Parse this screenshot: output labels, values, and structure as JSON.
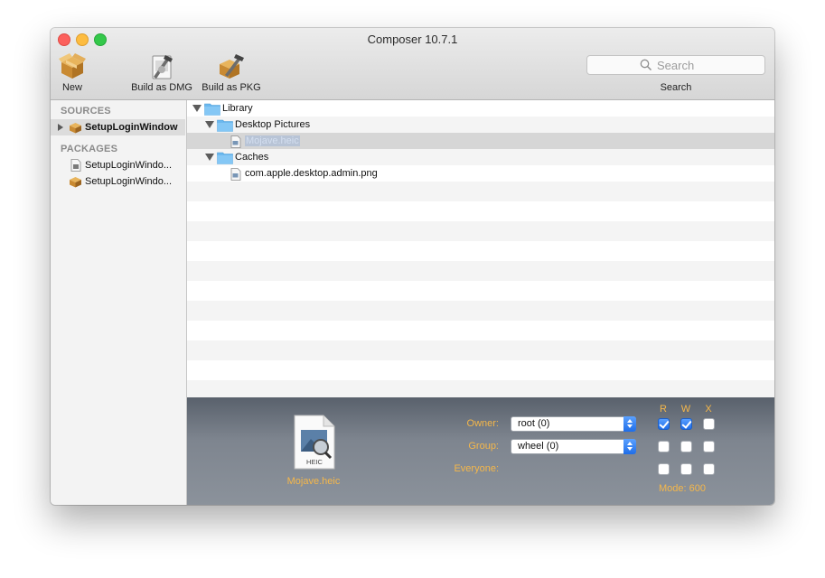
{
  "window": {
    "title": "Composer 10.7.1"
  },
  "toolbar": {
    "new_label": "New",
    "dmg_label": "Build as DMG",
    "pkg_label": "Build as PKG",
    "search_placeholder": "Search",
    "search_label": "Search"
  },
  "sidebar": {
    "sources_heading": "SOURCES",
    "sources": [
      {
        "label": "SetupLoginWindow",
        "icon": "package-box-icon",
        "selected": true
      }
    ],
    "packages_heading": "PACKAGES",
    "packages": [
      {
        "label": "SetupLoginWindo...",
        "icon": "dmg-document-icon"
      },
      {
        "label": "SetupLoginWindo...",
        "icon": "package-box-icon"
      }
    ]
  },
  "tree": {
    "items": [
      {
        "label": "Library",
        "type": "folder",
        "expanded": true
      },
      {
        "label": "Desktop Pictures",
        "type": "folder",
        "expanded": true
      },
      {
        "label": "Mojave.heic",
        "type": "file",
        "selected": true
      },
      {
        "label": "Caches",
        "type": "folder",
        "expanded": true
      },
      {
        "label": "com.apple.desktop.admin.png",
        "type": "file"
      }
    ]
  },
  "inspector": {
    "file_name": "Mojave.heic",
    "file_badge": "HEIC",
    "owner_label": "Owner:",
    "owner_value": "root (0)",
    "group_label": "Group:",
    "group_value": "wheel (0)",
    "everyone_label": "Everyone:",
    "perm_headers": [
      "R",
      "W",
      "X"
    ],
    "permissions": {
      "owner": [
        true,
        true,
        false
      ],
      "group": [
        false,
        false,
        false
      ],
      "everyone": [
        false,
        false,
        false
      ]
    },
    "mode_text": "Mode: 600"
  },
  "colors": {
    "accent_orange": "#f5b74a",
    "folder_blue": "#6bb8ee",
    "checkbox_blue": "#1f6de8"
  }
}
